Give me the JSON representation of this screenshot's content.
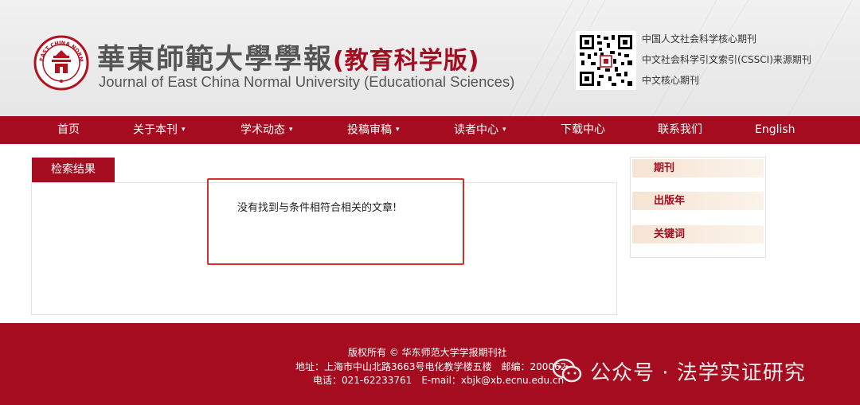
{
  "header": {
    "title_cn": "華東師範大學學報",
    "edition_cn": "(教育科学版)",
    "title_en": "Journal of East China Normal University (Educational Sciences)",
    "seal_text": "EAST CHINA NORMAL UNIVERSITY",
    "badges": [
      "中国人文社会科学核心期刊",
      "中文社会科学引文索引(CSSCI)来源期刊",
      "中文核心期刊"
    ]
  },
  "nav": {
    "items": [
      {
        "label": "首页",
        "caret": ""
      },
      {
        "label": "关于本刊",
        "caret": "▾"
      },
      {
        "label": "学术动态",
        "caret": "▾"
      },
      {
        "label": "投稿审稿",
        "caret": "▾"
      },
      {
        "label": "读者中心",
        "caret": "▾"
      },
      {
        "label": "下载中心",
        "caret": ""
      },
      {
        "label": "联系我们",
        "caret": ""
      },
      {
        "label": "English",
        "caret": ""
      }
    ]
  },
  "main": {
    "tab_label": "检索结果",
    "no_result_message": "没有找到与条件相符合相关的文章!"
  },
  "sidebar": {
    "items": [
      "期刊",
      "出版年",
      "关键词"
    ]
  },
  "footer": {
    "copyright": "版权所有 © 华东师范大学学报期刊社",
    "address": "地址：上海市中山北路3663号电化教学楼五楼　邮编：200062",
    "contact": "电话：021-62233761　E-mail：xbjk@xb.ecnu.edu.cn"
  },
  "watermark": {
    "text": "公众号 · 法学实证研究"
  },
  "colors": {
    "brand_red": "#a50c1f",
    "highlight_red": "#d82e2e"
  }
}
